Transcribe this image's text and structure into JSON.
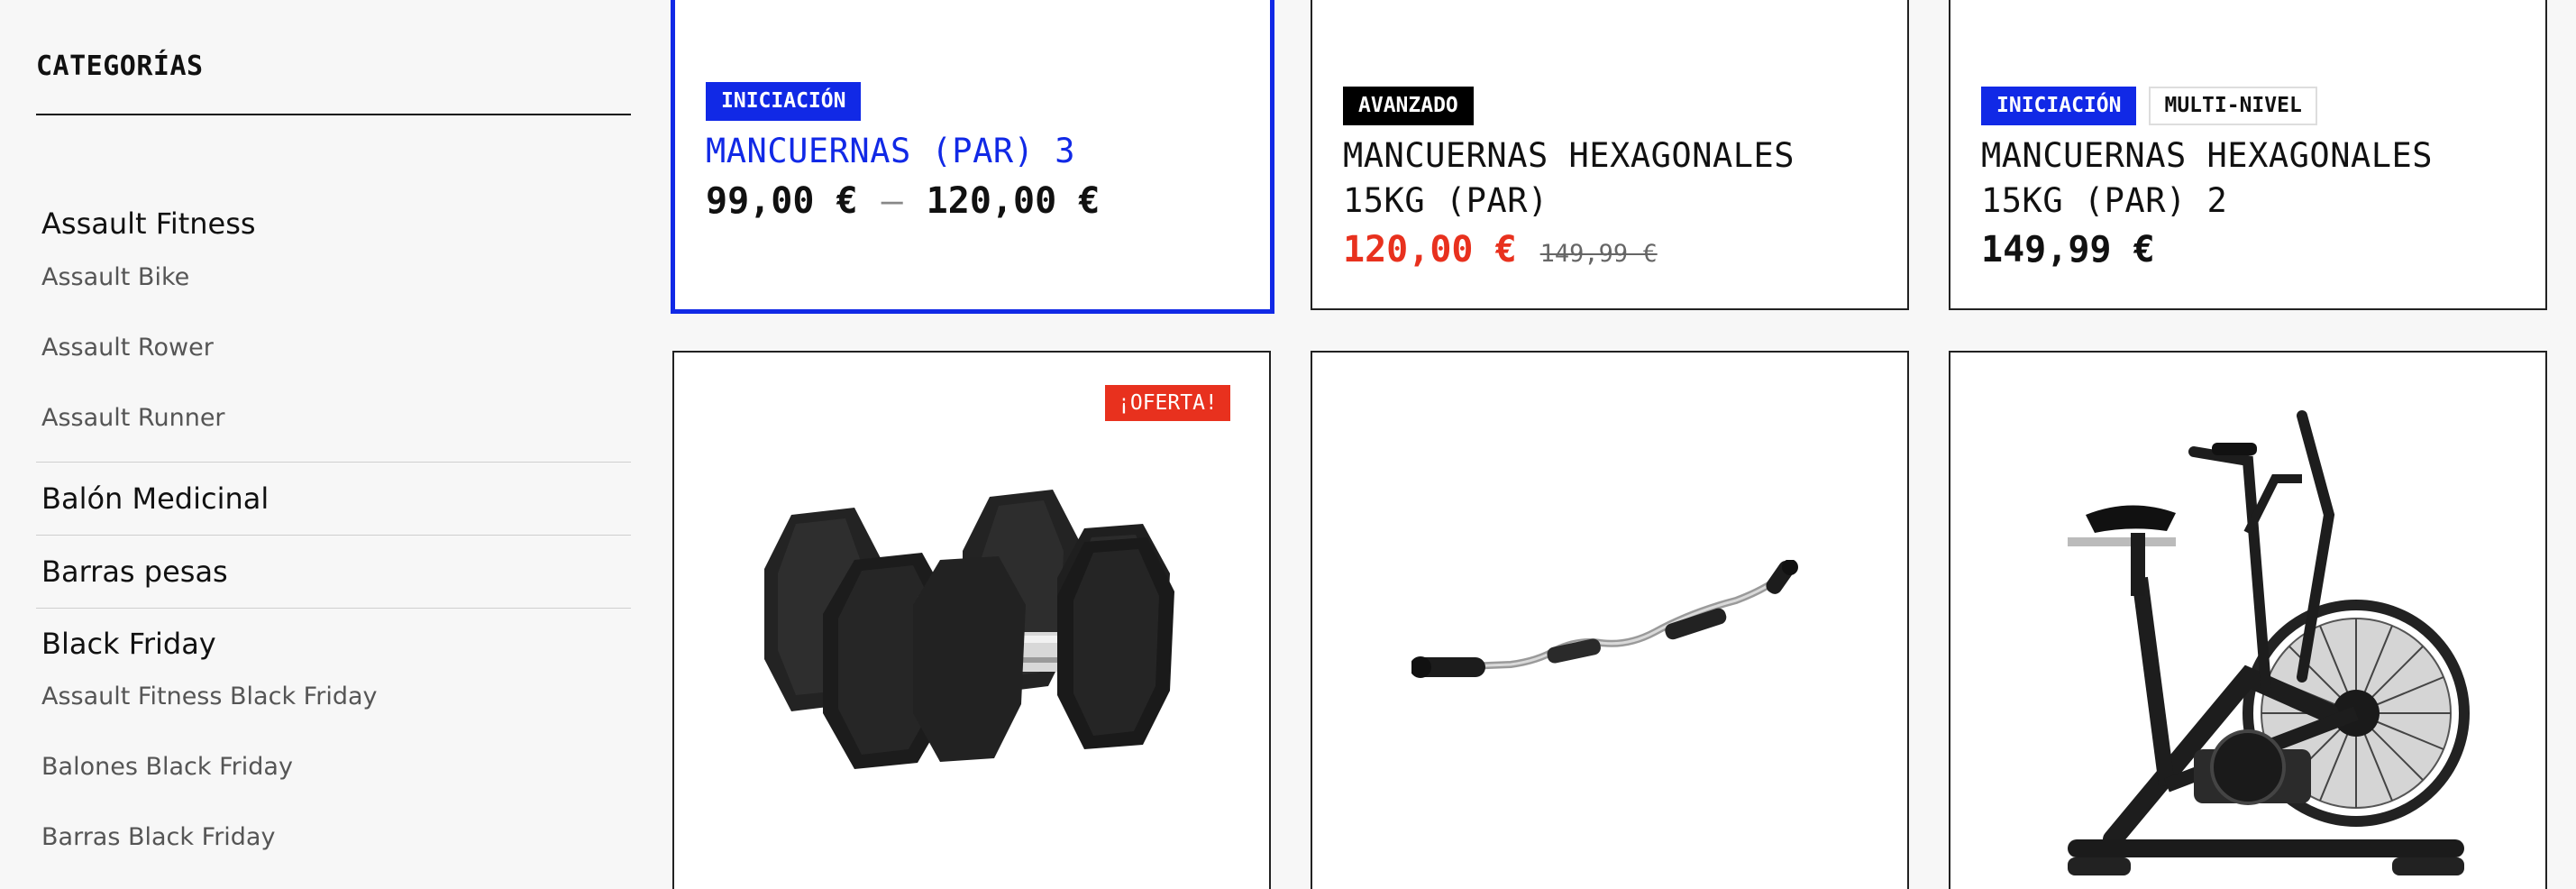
{
  "sidebar": {
    "title": "CATEGORÍAS",
    "groups": [
      {
        "label": "Assault Fitness",
        "items": [
          "Assault Bike",
          "Assault Rower",
          "Assault Runner"
        ]
      },
      {
        "label": "Balón Medicinal",
        "items": []
      },
      {
        "label": "Barras pesas",
        "items": []
      },
      {
        "label": "Black Friday",
        "items": [
          "Assault Fitness Black Friday",
          "Balones Black Friday",
          "Barras Black Friday"
        ]
      }
    ]
  },
  "products": [
    {
      "badges": [
        "INICIACIÓN"
      ],
      "name": "MANCUERNAS (PAR) 3",
      "price_from": "99,00 €",
      "price_sep": "–",
      "price_to": "120,00 €"
    },
    {
      "badges": [
        "AVANZADO"
      ],
      "name_line1": "MANCUERNAS HEXAGONALES",
      "name_line2": "15KG (PAR)",
      "price_sale": "120,00 €",
      "price_old": "149,99 €"
    },
    {
      "badges": [
        "INICIACIÓN",
        "MULTI-NIVEL"
      ],
      "name_line1": "MANCUERNAS HEXAGONALES",
      "name_line2": "15KG (PAR) 2",
      "price": "149,99 €"
    },
    {
      "offer_badge": "¡OFERTA!",
      "image_icon": "hex-dumbbells-icon"
    },
    {
      "image_icon": "curl-bar-icon"
    },
    {
      "image_icon": "air-bike-icon"
    }
  ],
  "colors": {
    "accent": "#1129e6",
    "sale": "#e8311e",
    "badge_black": "#000000",
    "background": "#f7f7f7"
  }
}
